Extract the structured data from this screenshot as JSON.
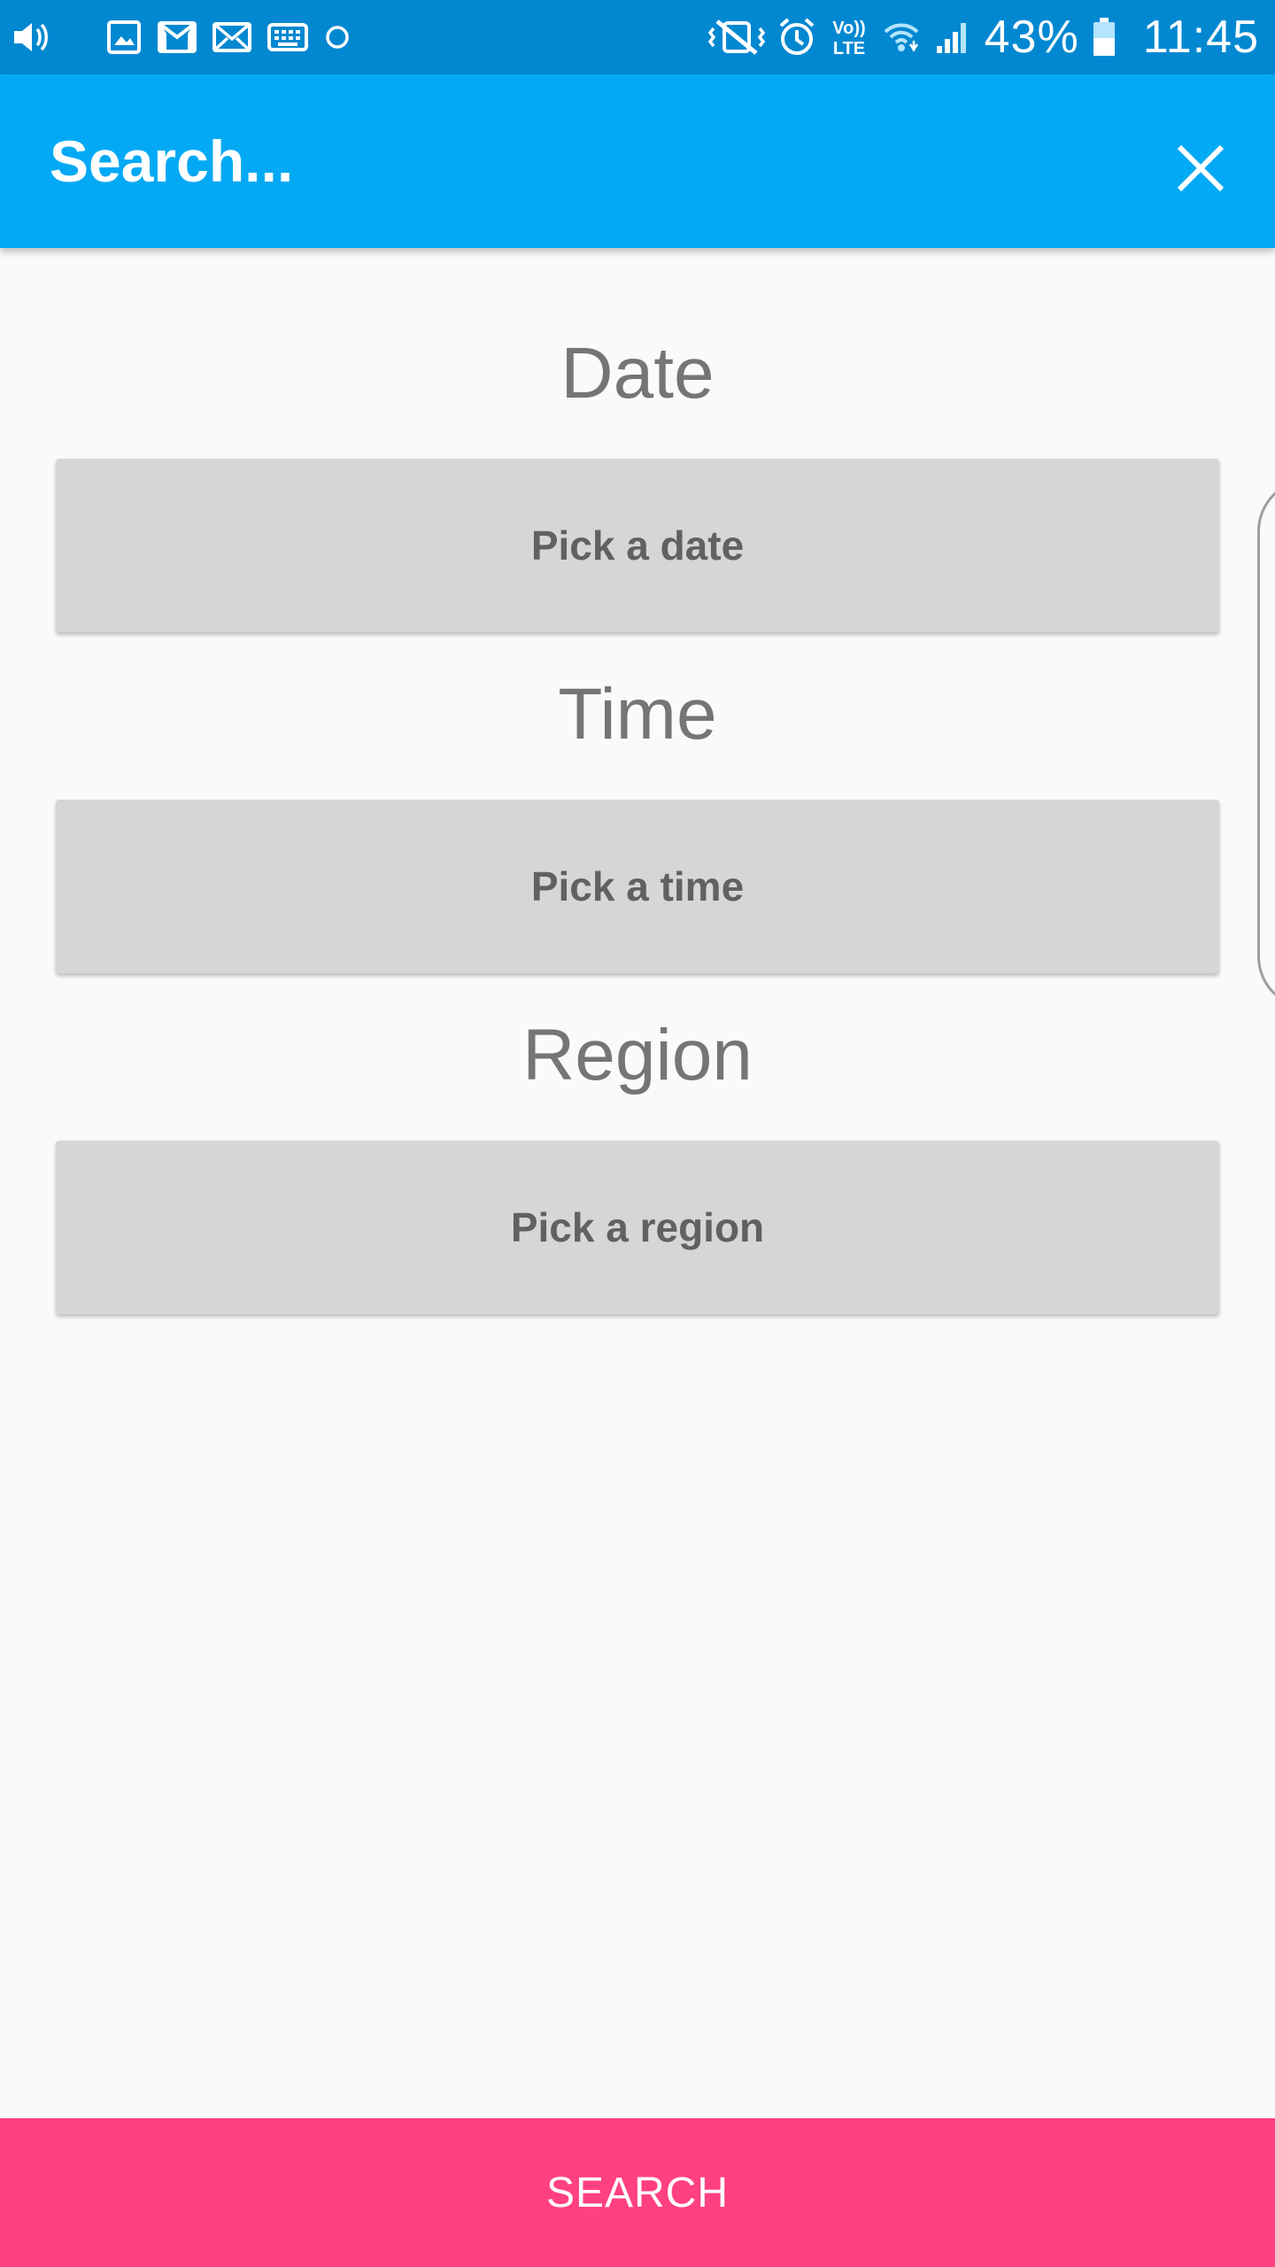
{
  "status_bar": {
    "left_icons": [
      "volume-icon",
      "gallery-icon",
      "gmail-icon",
      "email-icon",
      "keyboard-icon",
      "circle-icon"
    ],
    "right_icons": [
      "vibrate-icon",
      "alarm-icon",
      "volte-icon",
      "wifi-icon",
      "signal-icon",
      "battery-icon"
    ],
    "volte_label": "Vo)) LTE",
    "battery_percent": "43%",
    "time": "11:45"
  },
  "app_bar": {
    "title": "Search...",
    "close_icon": "close-icon"
  },
  "sections": {
    "date": {
      "label": "Date",
      "button": "Pick a date"
    },
    "time": {
      "label": "Time",
      "button": "Pick a time"
    },
    "region": {
      "label": "Region",
      "button": "Pick a region"
    }
  },
  "search_button": {
    "label": "SEARCH"
  },
  "colors": {
    "status_bar": "#0288d1",
    "app_bar": "#03a9f4",
    "accent": "#ff4081",
    "button_bg": "#d6d6d6",
    "text_gray": "#757575"
  }
}
